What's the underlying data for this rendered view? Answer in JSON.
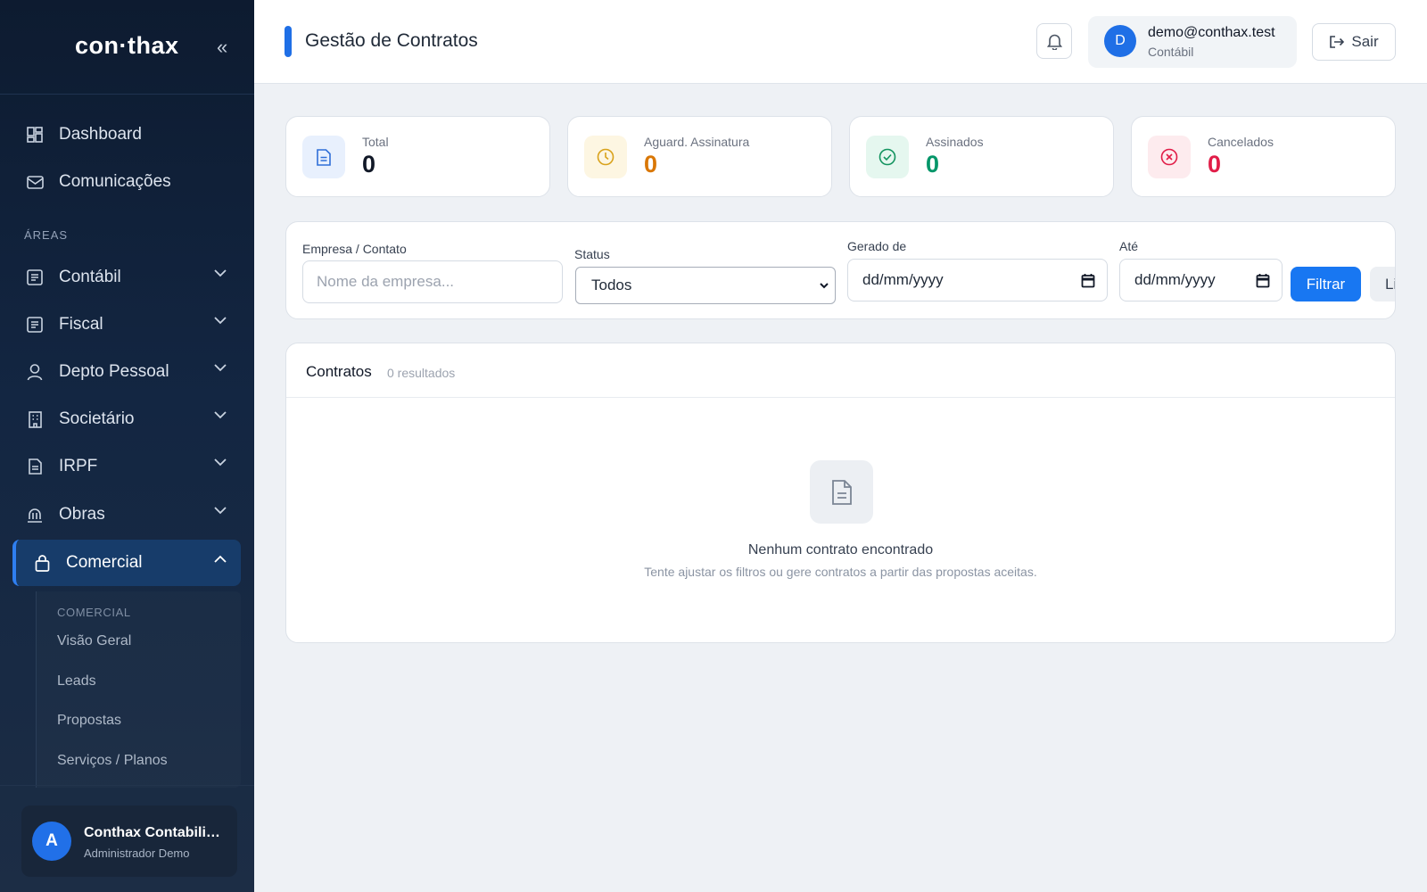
{
  "colors": {
    "accent": "#1f6fe6",
    "sidebar_bg": "#0d1b30",
    "pending": "#d97706",
    "signed": "#059669",
    "cancelled": "#e11d48"
  },
  "sidebar": {
    "logo": "con·thax",
    "collapse_icon": "double-chevron-left-icon",
    "top_items": [
      {
        "label": "Dashboard",
        "icon": "grid-icon"
      },
      {
        "label": "Comunicações",
        "icon": "mail-icon"
      }
    ],
    "section_label": "ÁREAS",
    "areas": [
      {
        "label": "Contábil",
        "icon": "ledger-icon"
      },
      {
        "label": "Fiscal",
        "icon": "receipt-icon"
      },
      {
        "label": "Depto Pessoal",
        "icon": "user-icon"
      },
      {
        "label": "Societário",
        "icon": "building-icon"
      },
      {
        "label": "IRPF",
        "icon": "document-icon"
      },
      {
        "label": "Obras",
        "icon": "construction-icon"
      },
      {
        "label": "Comercial",
        "icon": "bag-icon",
        "active": true
      }
    ],
    "submenu": {
      "label": "COMERCIAL",
      "items": [
        "Visão Geral",
        "Leads",
        "Propostas",
        "Serviços / Planos"
      ]
    },
    "user": {
      "initial": "A",
      "name": "Conthax Contabilidade",
      "role": "Administrador Demo"
    }
  },
  "header": {
    "title": "Gestão de Contratos",
    "account": {
      "initial": "D",
      "email": "demo@conthax.test",
      "area": "Contábil"
    },
    "logout_label": "Sair"
  },
  "stats": [
    {
      "label": "Total",
      "value": "0",
      "icon": "document-icon",
      "color": "#111827"
    },
    {
      "label": "Aguard. Assinatura",
      "value": "0",
      "icon": "clock-icon",
      "color": "#d97706"
    },
    {
      "label": "Assinados",
      "value": "0",
      "icon": "check-circle-icon",
      "color": "#059669"
    },
    {
      "label": "Cancelados",
      "value": "0",
      "icon": "x-circle-icon",
      "color": "#e11d48"
    }
  ],
  "filters": {
    "company_label": "Empresa / Contato",
    "company_placeholder": "Nome da empresa...",
    "status_label": "Status",
    "status_value": "Todos",
    "from_label": "Gerado de",
    "from_value": "dd/mm/yyyy",
    "to_label": "Até",
    "to_value": "dd/mm/yyyy",
    "filter_button": "Filtrar",
    "clear_button": "Limpar"
  },
  "contracts": {
    "title": "Contratos",
    "count": "0 resultados",
    "empty_title": "Nenhum contrato encontrado",
    "empty_subtitle": "Tente ajustar os filtros ou gere contratos a partir das propostas aceitas."
  }
}
